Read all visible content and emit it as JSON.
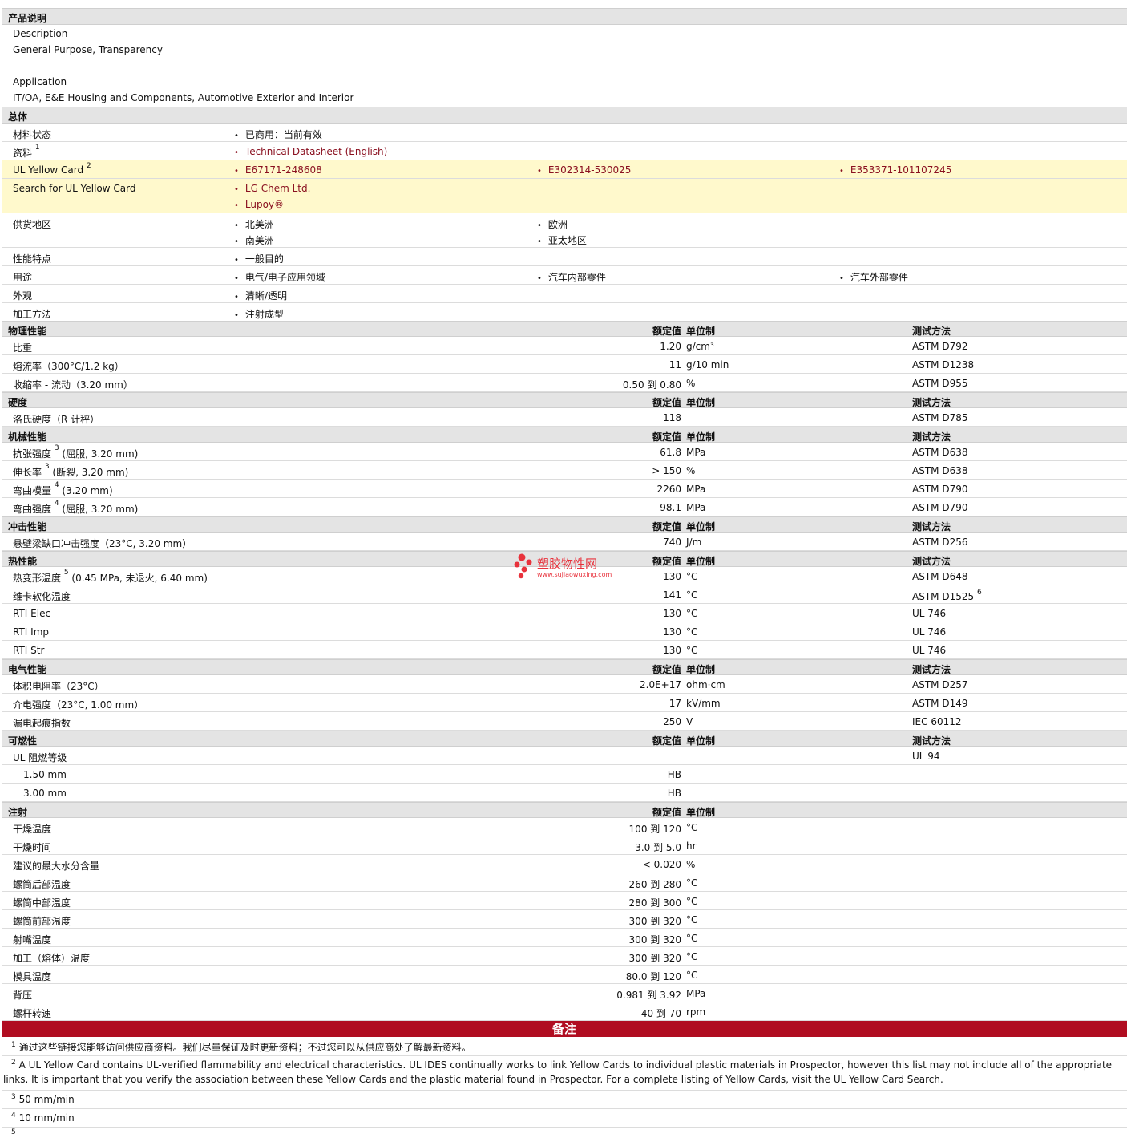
{
  "intro": {
    "header": "产品说明",
    "desc_label": "Description",
    "desc_value": "General Purpose, Transparency",
    "app_label": "Application",
    "app_value": "IT/OA, E&E Housing and Components, Automotive Exterior and Interior"
  },
  "general": {
    "header": "总体",
    "material_status_label": "材料状态",
    "material_status_value": "已商用：当前有效",
    "docs_label": "资料",
    "docs_sup": "1",
    "docs_link": "Technical Datasheet (English)",
    "ul_label": "UL Yellow Card",
    "ul_sup": "2",
    "ul_cards": [
      "E67171-248608",
      "E302314-530025",
      "E353371-101107245"
    ],
    "search_label": "Search for UL Yellow Card",
    "search_links": [
      "LG Chem Ltd.",
      "Lupoy®"
    ],
    "supply_label": "供货地区",
    "supply": [
      "北美洲",
      "欧洲",
      "南美洲",
      "亚太地区"
    ],
    "features_label": "性能特点",
    "features": [
      "一般目的"
    ],
    "uses_label": "用途",
    "uses": [
      "电气/电子应用领域",
      "汽车内部零件",
      "汽车外部零件"
    ],
    "appearance_label": "外观",
    "appearance": [
      "清晰/透明"
    ],
    "process_label": "加工方法",
    "process": [
      "注射成型"
    ]
  },
  "col_headers": {
    "value": "额定值",
    "unit": "单位制",
    "test": "测试方法"
  },
  "sections": {
    "physical": {
      "title": "物理性能",
      "rows": [
        {
          "label": "比重",
          "value": "1.20",
          "unit": "g/cm³",
          "test": "ASTM D792"
        },
        {
          "label": "熔流率（300°C/1.2 kg）",
          "value": "11",
          "unit": "g/10 min",
          "test": "ASTM D1238"
        },
        {
          "label": "收缩率 - 流动（3.20 mm）",
          "value": "0.50 到  0.80",
          "unit": "%",
          "test": "ASTM D955"
        }
      ]
    },
    "hardness": {
      "title": "硬度",
      "rows": [
        {
          "label": "洛氏硬度（R 计秤）",
          "value": "118",
          "unit": "",
          "test": "ASTM D785"
        }
      ]
    },
    "mechanical": {
      "title": "机械性能",
      "rows": [
        {
          "label": "抗张强度",
          "sup": "3",
          "suffix": "(屈服, 3.20 mm)",
          "value": "61.8",
          "unit": "MPa",
          "test": "ASTM D638"
        },
        {
          "label": "伸长率",
          "sup": "3",
          "suffix": "(断裂, 3.20 mm)",
          "value": "> 150",
          "unit": "%",
          "test": "ASTM D638"
        },
        {
          "label": "弯曲模量",
          "sup": "4",
          "suffix": "(3.20 mm)",
          "value": "2260",
          "unit": "MPa",
          "test": "ASTM D790"
        },
        {
          "label": "弯曲强度",
          "sup": "4",
          "suffix": "(屈服, 3.20 mm)",
          "value": "98.1",
          "unit": "MPa",
          "test": "ASTM D790"
        }
      ]
    },
    "impact": {
      "title": "冲击性能",
      "rows": [
        {
          "label": "悬壁梁缺口冲击强度（23°C, 3.20 mm）",
          "value": "740",
          "unit": "J/m",
          "test": "ASTM D256"
        }
      ]
    },
    "thermal": {
      "title": "热性能",
      "rows": [
        {
          "label": "热变形温度",
          "sup": "5",
          "suffix": "(0.45 MPa, 未退火, 6.40 mm)",
          "value": "130",
          "unit": "°C",
          "test": "ASTM D648"
        },
        {
          "label": "维卡软化温度",
          "value": "141",
          "unit": "°C",
          "test": "ASTM D1525",
          "test_sup": "6"
        },
        {
          "label": "RTI Elec",
          "value": "130",
          "unit": "°C",
          "test": "UL 746"
        },
        {
          "label": "RTI Imp",
          "value": "130",
          "unit": "°C",
          "test": "UL 746"
        },
        {
          "label": "RTI Str",
          "value": "130",
          "unit": "°C",
          "test": "UL 746"
        }
      ]
    },
    "electrical": {
      "title": "电气性能",
      "rows": [
        {
          "label": "体积电阻率（23°C）",
          "value": "2.0E+17",
          "unit": "ohm·cm",
          "test": "ASTM D257"
        },
        {
          "label": "介电强度（23°C, 1.00 mm）",
          "value": "17",
          "unit": "kV/mm",
          "test": "ASTM D149"
        },
        {
          "label": "漏电起痕指数",
          "value": "250",
          "unit": "V",
          "test": "IEC 60112"
        }
      ]
    },
    "flammability": {
      "title": "可燃性",
      "rows": [
        {
          "label": "UL 阻燃等级",
          "value": "",
          "unit": "",
          "test": "UL 94"
        },
        {
          "label": "1.50 mm",
          "indent": true,
          "value": "HB",
          "unit": "",
          "test": ""
        },
        {
          "label": "3.00 mm",
          "indent": true,
          "value": "HB",
          "unit": "",
          "test": ""
        }
      ]
    },
    "injection": {
      "title": "注射",
      "rows": [
        {
          "label": "干燥温度",
          "value": "100 到  120",
          "unit": "°C"
        },
        {
          "label": "干燥时间",
          "value": "3.0 到  5.0",
          "unit": "hr"
        },
        {
          "label": "建议的最大水分含量",
          "value": "< 0.020",
          "unit": "%"
        },
        {
          "label": "螺筒后部温度",
          "value": "260 到  280",
          "unit": "°C"
        },
        {
          "label": "螺筒中部温度",
          "value": "280 到  300",
          "unit": "°C"
        },
        {
          "label": "螺筒前部温度",
          "value": "300 到  320",
          "unit": "°C"
        },
        {
          "label": "射嘴温度",
          "value": "300 到  320",
          "unit": "°C"
        },
        {
          "label": "加工（熔体）温度",
          "value": "300 到  320",
          "unit": "°C"
        },
        {
          "label": "模具温度",
          "value": "80.0 到  120",
          "unit": "°C"
        },
        {
          "label": "背压",
          "value": "0.981 到  3.92",
          "unit": "MPa"
        },
        {
          "label": "螺杆转速",
          "value": "40 到  70",
          "unit": "rpm"
        }
      ]
    }
  },
  "notes": {
    "title": "备注",
    "items": [
      {
        "num": "1",
        "text": "通过这些链接您能够访问供应商资料。我们尽量保证及时更新资料；不过您可以从供应商处了解最新资料。"
      },
      {
        "num": "2",
        "text": "A UL Yellow Card contains UL-verified flammability and electrical characteristics. UL IDES continually works to link Yellow Cards to individual plastic materials in Prospector, however this list may not include all of the appropriate links. It is important that you verify the association between these Yellow Cards and the plastic material found in Prospector. For a complete listing of Yellow Cards, visit the UL Yellow Card Search."
      },
      {
        "num": "3",
        "text": "50 mm/min"
      },
      {
        "num": "4",
        "text": "10 mm/min"
      },
      {
        "num": "5",
        "text": ""
      }
    ]
  },
  "watermark": {
    "title": "塑胶物性网",
    "url": "www.sujiaowuxing.com",
    "color": "#e8323c"
  },
  "colors": {
    "header_bg": "#e4e4e4",
    "highlight_bg": "#fff9cc",
    "notes_bar": "#b00d21",
    "link": "#8a1020"
  }
}
